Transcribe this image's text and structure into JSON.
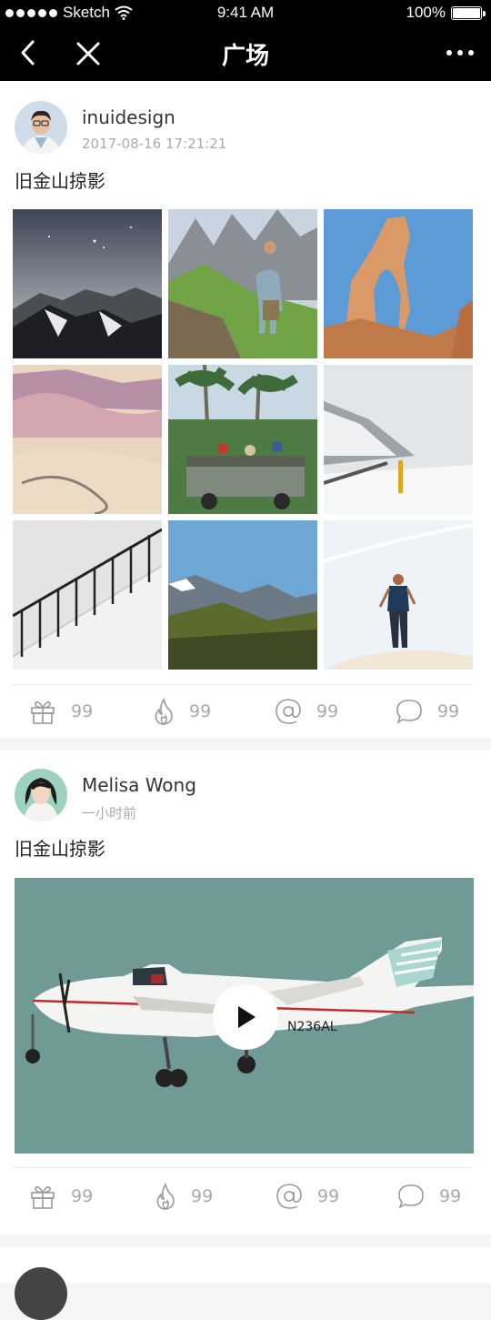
{
  "status_bar": {
    "carrier": "Sketch",
    "time": "9:41 AM",
    "battery": "100%",
    "battery_level": 1.0
  },
  "nav": {
    "title": "广场"
  },
  "posts": [
    {
      "username": "inuidesign",
      "timestamp": "2017-08-16 17:21:21",
      "text": "旧金山掠影",
      "photos": [
        "starry-mountains",
        "hiker-on-ridge",
        "desert-arch",
        "sand-dunes",
        "tropical-jeep",
        "snowy-road",
        "staircase",
        "mountain-valley",
        "walker-on-dune"
      ],
      "stats": {
        "gift": "99",
        "fire": "99",
        "mention": "99",
        "comment": "99"
      }
    },
    {
      "username": "Melisa Wong",
      "timestamp": "一小时前",
      "text": "旧金山掠影",
      "video": {
        "subject": "airplane",
        "tail_number": "N236AL"
      },
      "stats": {
        "gift": "99",
        "fire": "99",
        "mention": "99",
        "comment": "99"
      }
    }
  ]
}
